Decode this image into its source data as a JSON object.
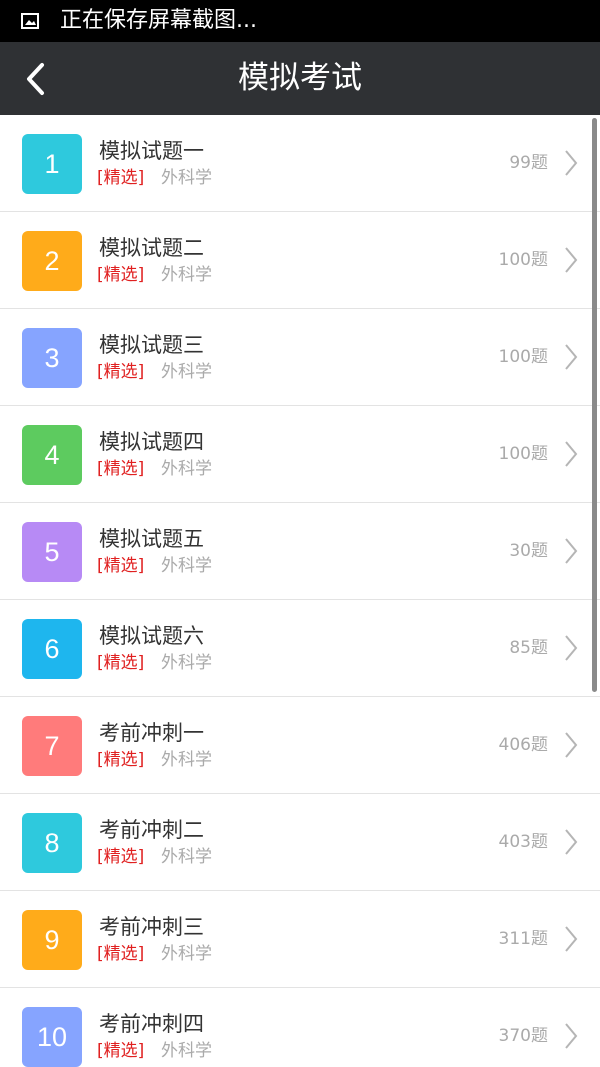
{
  "status_bar": {
    "text": "正在保存屏幕截图..."
  },
  "header": {
    "title": "模拟考试"
  },
  "colors": {
    "header_bg": "#2f3134",
    "tag_red": "#e02020"
  },
  "items": [
    {
      "number": "1",
      "title": "模拟试题一",
      "tag": "[精选]",
      "subject": "外科学",
      "count": "99题",
      "color": "#2ec9dd"
    },
    {
      "number": "2",
      "title": "模拟试题二",
      "tag": "[精选]",
      "subject": "外科学",
      "count": "100题",
      "color": "#ffab1a"
    },
    {
      "number": "3",
      "title": "模拟试题三",
      "tag": "[精选]",
      "subject": "外科学",
      "count": "100题",
      "color": "#86a4ff"
    },
    {
      "number": "4",
      "title": "模拟试题四",
      "tag": "[精选]",
      "subject": "外科学",
      "count": "100题",
      "color": "#5dcb5f"
    },
    {
      "number": "5",
      "title": "模拟试题五",
      "tag": "[精选]",
      "subject": "外科学",
      "count": "30题",
      "color": "#b78af5"
    },
    {
      "number": "6",
      "title": "模拟试题六",
      "tag": "[精选]",
      "subject": "外科学",
      "count": "85题",
      "color": "#1eb6ee"
    },
    {
      "number": "7",
      "title": "考前冲刺一",
      "tag": "[精选]",
      "subject": "外科学",
      "count": "406题",
      "color": "#ff7b7b"
    },
    {
      "number": "8",
      "title": "考前冲刺二",
      "tag": "[精选]",
      "subject": "外科学",
      "count": "403题",
      "color": "#2ec9dd"
    },
    {
      "number": "9",
      "title": "考前冲刺三",
      "tag": "[精选]",
      "subject": "外科学",
      "count": "311题",
      "color": "#ffab1a"
    },
    {
      "number": "10",
      "title": "考前冲刺四",
      "tag": "[精选]",
      "subject": "外科学",
      "count": "370题",
      "color": "#86a4ff"
    }
  ]
}
